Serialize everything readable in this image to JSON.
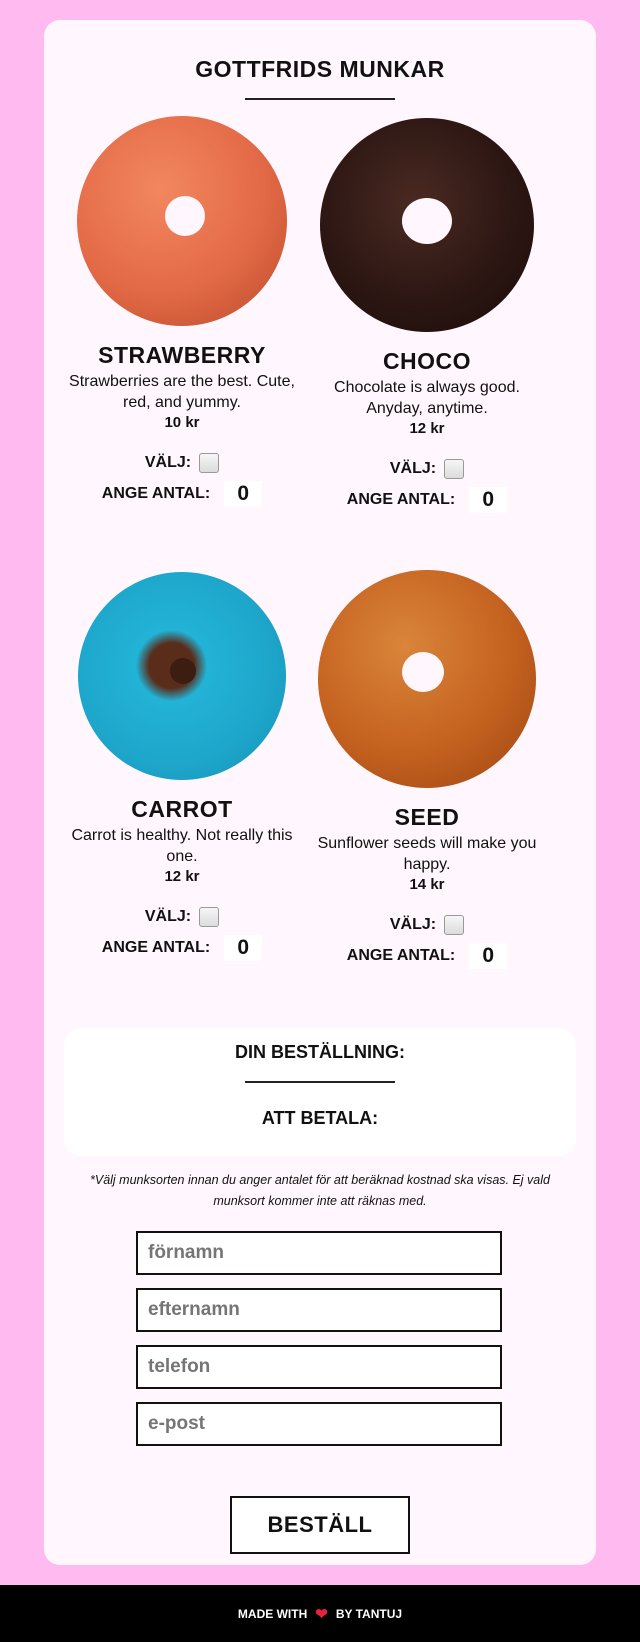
{
  "page": {
    "title": "GOTTFRIDS MUNKAR"
  },
  "products": [
    {
      "name": "STRAWBERRY",
      "description": "Strawberries are the best. Cute, red, and yummy.",
      "price": "10 kr",
      "select_label": "VÄLJ:",
      "quantity_label": "ANGE ANTAL:",
      "quantity": "0",
      "selected": false,
      "color": "#e36a46"
    },
    {
      "name": "CHOCO",
      "description": "Chocolate is always good. Anyday, anytime.",
      "price": "12 kr",
      "select_label": "VÄLJ:",
      "quantity_label": "ANGE ANTAL:",
      "quantity": "0",
      "selected": false,
      "color": "#2a1512"
    },
    {
      "name": "CARROT",
      "description": "Carrot is healthy. Not really this one.",
      "price": "12 kr",
      "select_label": "VÄLJ:",
      "quantity_label": "ANGE ANTAL:",
      "quantity": "0",
      "selected": false,
      "color": "#22b3d6"
    },
    {
      "name": "SEED",
      "description": "Sunflower seeds will make you happy.",
      "price": "14 kr",
      "select_label": "VÄLJ:",
      "quantity_label": "ANGE ANTAL:",
      "quantity": "0",
      "selected": false,
      "color": "#c4611f"
    }
  ],
  "summary": {
    "order_label": "DIN BESTÄLLNING:",
    "total_label": "ATT BETALA:"
  },
  "note": "*Välj munksorten innan du anger antalet för att beräknad kostnad ska visas. Ej vald munksort kommer inte att räknas med.",
  "form": {
    "first_name_placeholder": "förnamn",
    "last_name_placeholder": "efternamn",
    "phone_placeholder": "telefon",
    "email_placeholder": "e-post",
    "submit_label": "BESTÄLL"
  },
  "footer": {
    "text_before": "MADE WITH",
    "heart_icon": "heart-icon",
    "text_after": "BY TANTUJ",
    "heart_color": "#e4233c"
  }
}
